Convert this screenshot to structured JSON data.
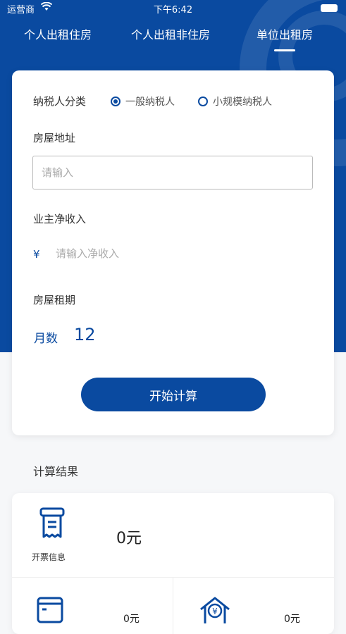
{
  "status_bar": {
    "carrier": "运营商",
    "time": "下午6:42"
  },
  "tabs": [
    {
      "label": "个人出租住房",
      "active": false
    },
    {
      "label": "个人出租非住房",
      "active": false
    },
    {
      "label": "单位出租房",
      "active": true
    }
  ],
  "form": {
    "taxpayer_label": "纳税人分类",
    "taxpayer_options": [
      {
        "label": "一般纳税人",
        "selected": true
      },
      {
        "label": "小规模纳税人",
        "selected": false
      }
    ],
    "address_label": "房屋地址",
    "address_placeholder": "请输入",
    "income_label": "业主净收入",
    "income_currency": "¥",
    "income_placeholder": "请输入净收入",
    "term_label": "房屋租期",
    "months_label": "月数",
    "months_value": "12",
    "calculate_button": "开始计算"
  },
  "results": {
    "title": "计算结果",
    "invoice_label": "开票信息",
    "invoice_amount": "0元",
    "item2_amount": "0元",
    "item3_amount": "0元"
  },
  "colors": {
    "primary": "#0a4aa0",
    "background": "#f6f7f9"
  }
}
